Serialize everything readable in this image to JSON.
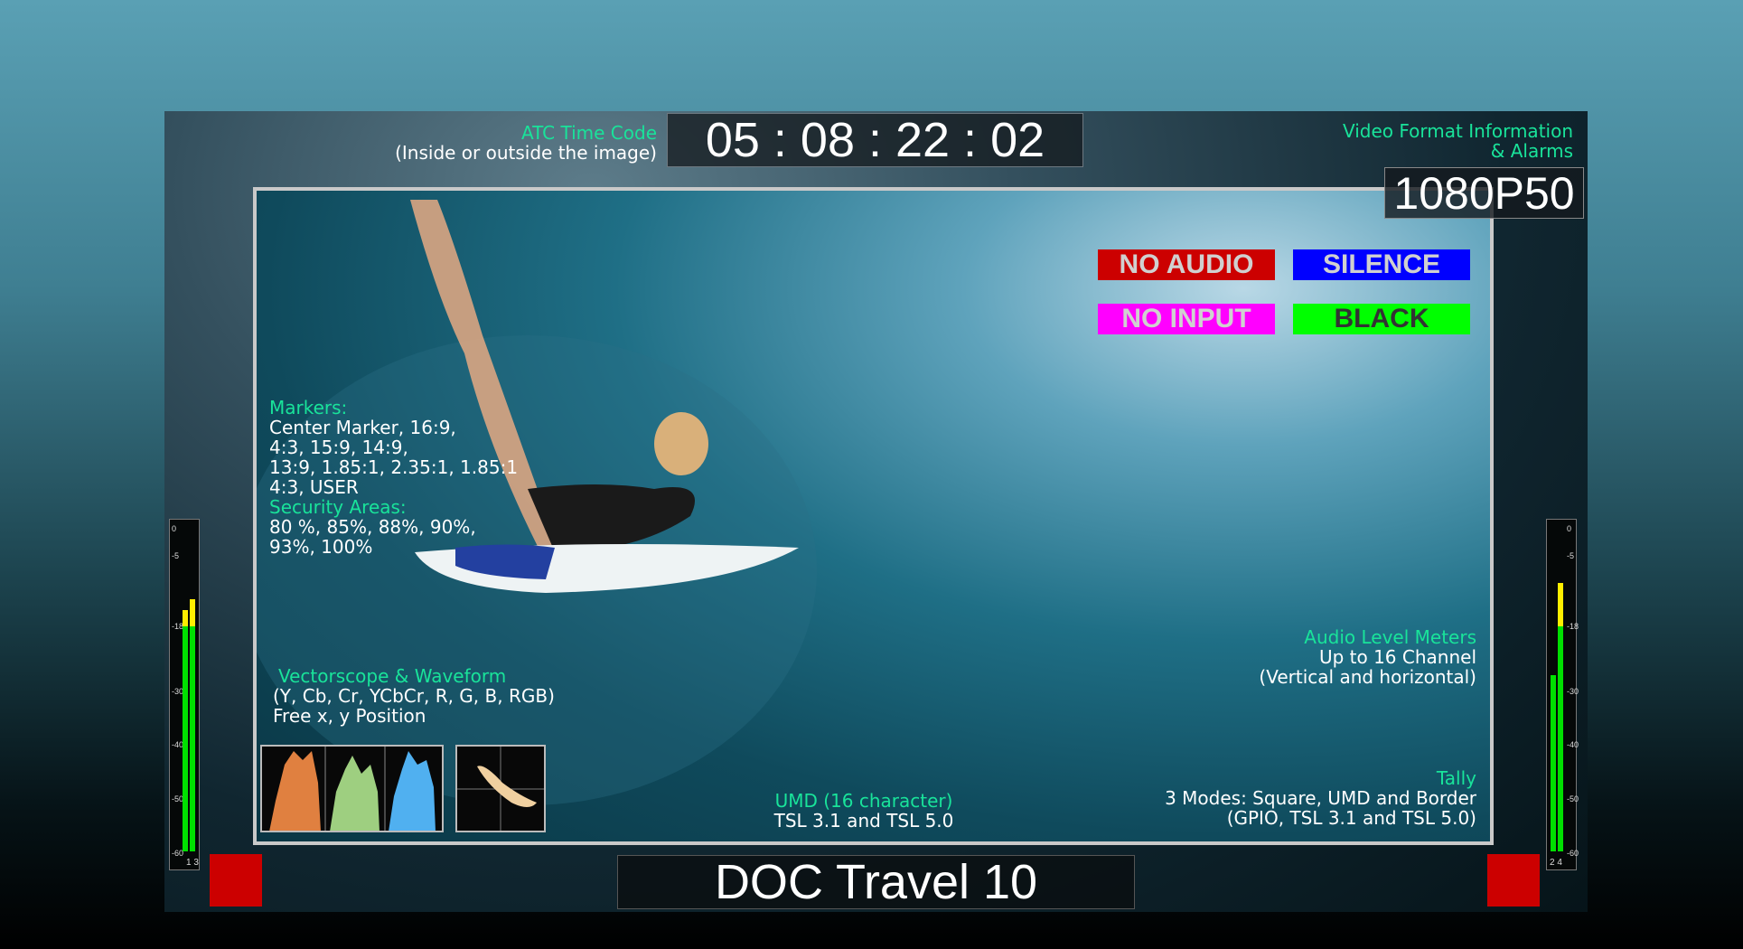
{
  "timecode": {
    "label": "ATC Time Code",
    "sublabel": "(Inside or outside the image)",
    "value": "05 : 08 : 22 : 02"
  },
  "video_format": {
    "label_line1": "Video Format Information",
    "label_line2": "& Alarms",
    "value": "1080P50"
  },
  "alarms": [
    {
      "text": "NO AUDIO",
      "bg": "#cc0000",
      "fg": "#d0d0d0"
    },
    {
      "text": "SILENCE",
      "bg": "#0000ff",
      "fg": "#d0d0d0"
    },
    {
      "text": "NO INPUT",
      "bg": "#ff00ff",
      "fg": "#d0d0d0"
    },
    {
      "text": "BLACK",
      "bg": "#00ff00",
      "fg": "#333333"
    }
  ],
  "markers": {
    "title": "Markers:",
    "lines": [
      "Center Marker, 16:9,",
      "4:3, 15:9, 14:9,",
      "13:9, 1.85:1, 2.35:1, 1.85:1",
      "4:3, USER"
    ],
    "security_title": "Security Areas:",
    "security_lines": [
      "80 %, 85%, 88%, 90%,",
      "93%, 100%"
    ]
  },
  "scopes": {
    "title": "Vectorscope & Waveform",
    "line1": "(Y, Cb, Cr, YCbCr, R, G, B, RGB)",
    "line2": "Free x, y Position"
  },
  "umd_info": {
    "title": "UMD (16 character)",
    "line1": "TSL 3.1 and TSL 5.0"
  },
  "audio_info": {
    "title": "Audio Level Meters",
    "line1": "Up to 16 Channel",
    "line2": "(Vertical and horizontal)"
  },
  "tally_info": {
    "title": "Tally",
    "line1": "3 Modes: Square, UMD and Border",
    "line2": "(GPIO, TSL 3.1 and TSL 5.0)"
  },
  "umd": {
    "value": "DOC Travel 10"
  },
  "meter_scale": [
    "0",
    "-5",
    "-18",
    "-30",
    "-40",
    "-50",
    "-60"
  ],
  "meters": [
    {
      "channels": "1 3",
      "levels_db": [
        -15,
        -13
      ]
    },
    {
      "channels": "2 4",
      "levels_db": [
        -27,
        -10
      ]
    }
  ],
  "tally_color": "#cc0000",
  "colors": {
    "accent": "#19e39a",
    "meter_green": "#00e000",
    "meter_yellow": "#ffee00"
  }
}
